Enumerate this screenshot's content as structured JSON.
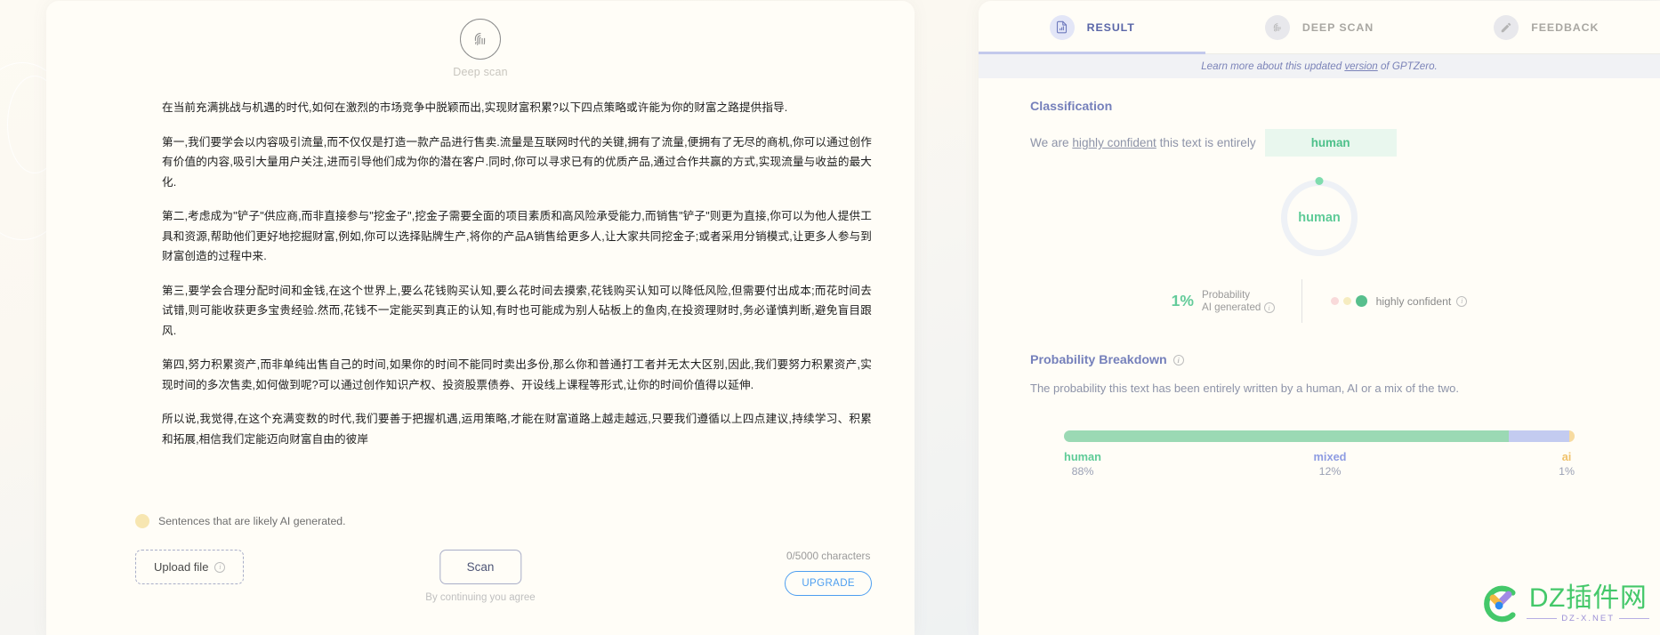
{
  "left": {
    "deep_scan_label": "Deep scan",
    "fingerprint_icon": "fingerprint-icon",
    "paragraphs": [
      "在当前充满挑战与机遇的时代,如何在激烈的市场竞争中脱颖而出,实现财富积累?以下四点策略或许能为你的财富之路提供指导.",
      "第一,我们要学会以内容吸引流量,而不仅仅是打造一款产品进行售卖.流量是互联网时代的关键,拥有了流量,便拥有了无尽的商机,你可以通过创作有价值的内容,吸引大量用户关注,进而引导他们成为你的潜在客户.同时,你可以寻求已有的优质产品,通过合作共赢的方式,实现流量与收益的最大化.",
      "第二,考虑成为\"铲子\"供应商,而非直接参与\"挖金子\",挖金子需要全面的项目素质和高风险承受能力,而销售\"铲子\"则更为直接,你可以为他人提供工具和资源,帮助他们更好地挖掘财富,例如,你可以选择贴牌生产,将你的产品A销售给更多人,让大家共同挖金子;或者采用分销模式,让更多人参与到财富创造的过程中来.",
      "第三,要学会合理分配时间和金钱,在这个世界上,要么花钱购买认知,要么花时间去摸索,花钱购买认知可以降低风险,但需要付出成本;而花时间去试错,则可能收获更多宝贵经验.然而,花钱不一定能买到真正的认知,有时也可能成为别人砧板上的鱼肉,在投资理财时,务必谨慎判断,避免盲目跟风.",
      "第四,努力积累资产,而非单纯出售自己的时间,如果你的时间不能同时卖出多份,那么你和普通打工者并无太大区别,因此,我们要努力积累资产,实现时间的多次售卖,如何做到呢?可以通过创作知识产权、投资股票债券、开设线上课程等形式,让你的时间价值得以延伸.",
      "所以说,我觉得,在这个充满变数的时代,我们要善于把握机遇,运用策略,才能在财富道路上越走越远,只要我们遵循以上四点建议,持续学习、积累和拓展,相信我们定能迈向财富自由的彼岸"
    ],
    "legend_text": "Sentences that are likely AI generated.",
    "legend_color": "#f7e6b1",
    "upload_label": "Upload file",
    "scan_label": "Scan",
    "scan_sub": "By continuing you agree",
    "characters": "0/5000 characters",
    "upgrade_label": "UPGRADE"
  },
  "right": {
    "tabs": [
      {
        "label": "RESULT",
        "icon": "document-chart-icon",
        "active": true
      },
      {
        "label": "DEEP SCAN",
        "icon": "fingerprint-icon",
        "active": false
      },
      {
        "label": "FEEDBACK",
        "icon": "pencil-icon",
        "active": false
      }
    ],
    "version_bar": {
      "prefix": "Learn more about this updated ",
      "link": "version",
      "suffix": " of GPTZero."
    },
    "classification": {
      "title": "Classification",
      "lead": "We are ",
      "emphasis": "highly confident",
      "tail": " this text is entirely",
      "verdict": "human",
      "verdict_color": "#4dc08a"
    },
    "gauge": {
      "label": "human",
      "value": 1,
      "track_color": "#eef1f6",
      "knob_color": "#7fdcae"
    },
    "stats": {
      "probability_pct": "1%",
      "probability_line1": "Probability",
      "probability_line2": "AI generated",
      "confidence_label": "highly confident",
      "dots": [
        "#f9dada",
        "#f6ecc0",
        "#57bf8d"
      ]
    },
    "breakdown": {
      "title": "Probability Breakdown",
      "description": "The probability this text has been entirely written by a human, AI or a mix of the two."
    },
    "info_icon": "info-icon"
  },
  "chart_data": {
    "type": "bar",
    "title": "Probability Breakdown",
    "subtitle": "The probability this text has been entirely written by a human, AI or a mix of the two.",
    "orientation": "horizontal-stacked",
    "categories": [
      "human",
      "mixed",
      "ai"
    ],
    "values": [
      88,
      12,
      1
    ],
    "value_labels": [
      "88%",
      "12%",
      "1%"
    ],
    "colors": [
      "#9bd9b4",
      "#c3cbf0",
      "#f7dba0"
    ],
    "xlabel": "",
    "ylabel": "",
    "ylim": [
      0,
      100
    ],
    "grid": false,
    "legend": "below-bar",
    "annotations": [
      {
        "text": "1%",
        "meaning": "Probability AI generated"
      },
      {
        "text": "human",
        "meaning": "overall classification"
      },
      {
        "text": "highly confident",
        "meaning": "confidence level"
      }
    ]
  },
  "watermark": {
    "title": "DZ插件网",
    "subtitle": "DZ-X.NET",
    "title_color": "#44c86a",
    "subtitle_color": "#9b8fd6"
  }
}
